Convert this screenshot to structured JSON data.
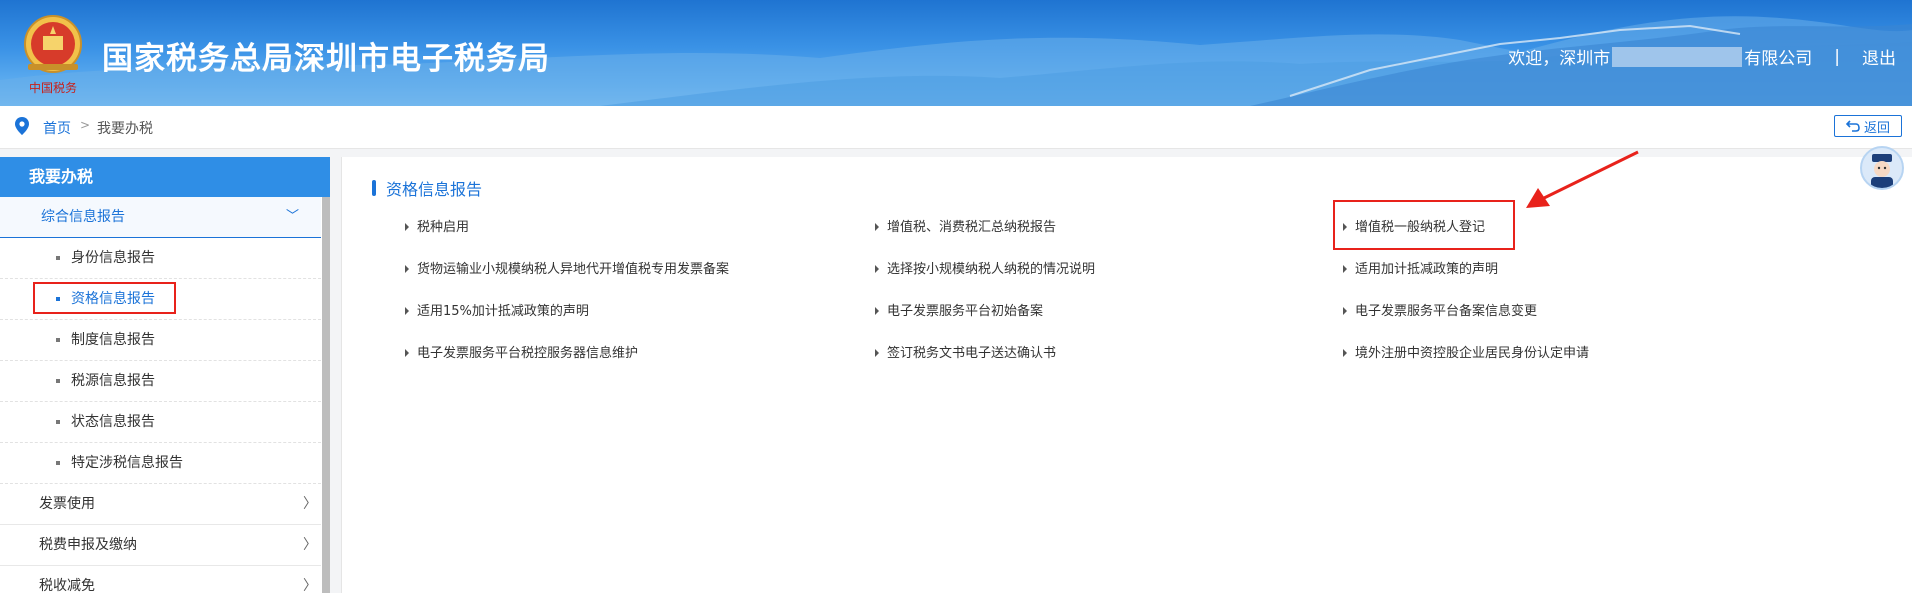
{
  "header": {
    "site_title": "国家税务总局深圳市电子税务局",
    "logo_caption": "中国税务",
    "welcome_prefix": "欢迎，深圳市",
    "company_suffix": "有限公司",
    "separator": "|",
    "logout_label": "退出"
  },
  "breadcrumb": {
    "home": "首页",
    "arrow": ">",
    "current": "我要办税",
    "back_label": "返回"
  },
  "sidebar": {
    "title": "我要办税",
    "group": {
      "label": "综合信息报告",
      "chevron": "﹀"
    },
    "sub_items": [
      {
        "label": "身份信息报告",
        "active": false
      },
      {
        "label": "资格信息报告",
        "active": true
      },
      {
        "label": "制度信息报告",
        "active": false
      },
      {
        "label": "税源信息报告",
        "active": false
      },
      {
        "label": "状态信息报告",
        "active": false
      },
      {
        "label": "特定涉税信息报告",
        "active": false
      }
    ],
    "categories": [
      {
        "label": "发票使用",
        "chevron": "〉"
      },
      {
        "label": "税费申报及缴纳",
        "chevron": "〉"
      },
      {
        "label": "税收减免",
        "chevron": "〉"
      }
    ]
  },
  "main": {
    "section_title": "资格信息报告",
    "links": [
      {
        "label": "税种启用"
      },
      {
        "label": "增值税、消费税汇总纳税报告"
      },
      {
        "label": "增值税一般纳税人登记"
      },
      {
        "label": "货物运输业小规模纳税人异地代开增值税专用发票备案"
      },
      {
        "label": "选择按小规模纳税人纳税的情况说明"
      },
      {
        "label": "适用加计抵减政策的声明"
      },
      {
        "label": "适用15%加计抵减政策的声明"
      },
      {
        "label": "电子发票服务平台初始备案"
      },
      {
        "label": "电子发票服务平台备案信息变更"
      },
      {
        "label": "电子发票服务平台税控服务器信息维护"
      },
      {
        "label": "签订税务文书电子送达确认书"
      },
      {
        "label": "境外注册中资控股企业居民身份认定申请"
      }
    ]
  },
  "colors": {
    "primary": "#1b73d8",
    "header_blue": "#2f8ee6",
    "highlight_red": "#e8221b"
  },
  "icons": {
    "location": "location-pin-icon",
    "back": "return-arrow-icon",
    "link_marker": "triangle-right-icon",
    "assistant": "assistant-avatar-icon"
  }
}
